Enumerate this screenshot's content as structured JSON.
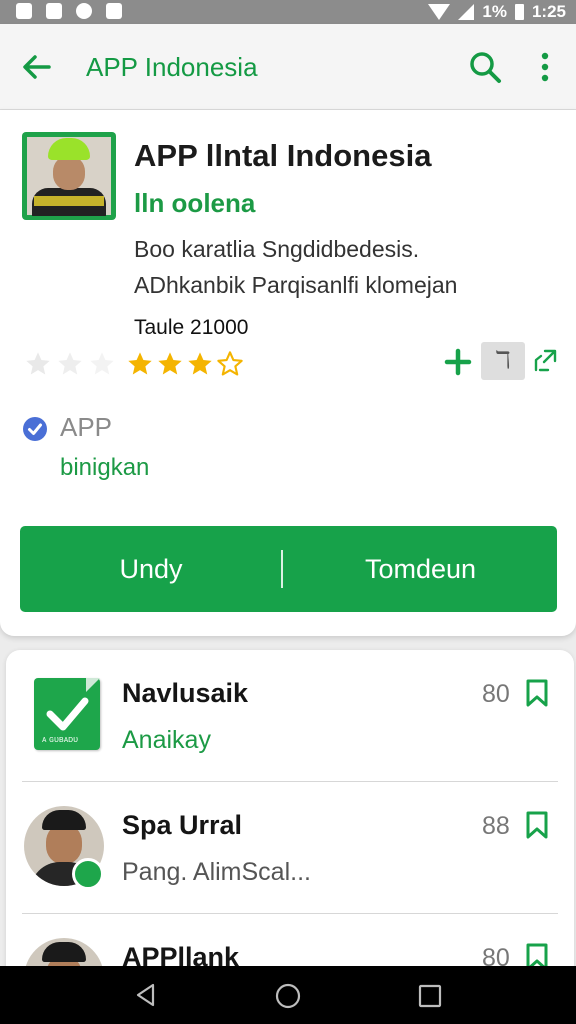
{
  "status_bar": {
    "battery": "1%",
    "time": "1:25"
  },
  "app_bar": {
    "title": "APP  Indonesia"
  },
  "app": {
    "name": "APP  llntal Indonesia",
    "developer": "lln oolena",
    "description_line1": "Boo karatlia Sngdidbedesis.",
    "description_line2": "ADhkanbik Parqisanlfi klomejan",
    "downloads": "Taule 21000",
    "rating_filled_stars": 3,
    "rating_total_stars": 4,
    "action_box_label": "ℸ",
    "verified_label": "APP",
    "category": "binigkan"
  },
  "buttons": {
    "install": "Undy",
    "open": "Tomdeun"
  },
  "list": [
    {
      "title": "Navlusaik",
      "subtitle": "Anaikay",
      "count": "80",
      "icon": "check-document-icon",
      "icon_caption": "ᴀ ɢᴜʙᴀᴅᴜ"
    },
    {
      "title": "Spa Urral",
      "subtitle": "Pang. AlimScal...",
      "count": "88",
      "icon": "avatar"
    },
    {
      "title": "APPllank",
      "subtitle": "",
      "count": "80",
      "icon": "avatar"
    }
  ],
  "colors": {
    "accent": "#17a24a",
    "status_bar": "#8c8c8c",
    "nav_bar": "#000000"
  }
}
